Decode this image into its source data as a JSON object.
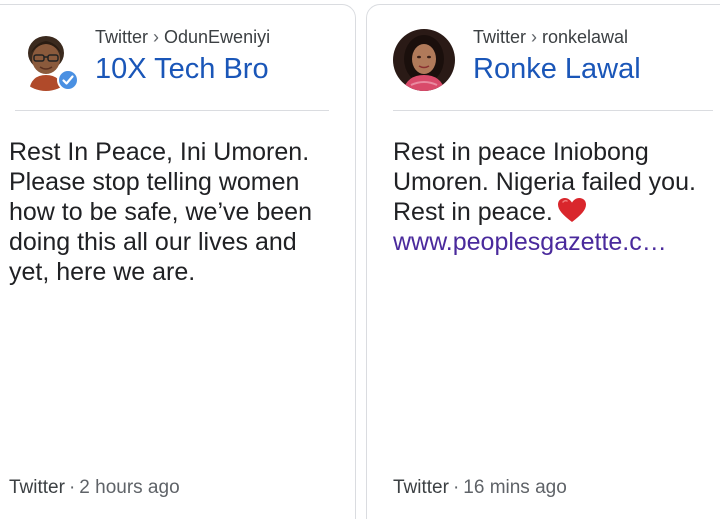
{
  "cards": [
    {
      "source": "Twitter",
      "handle": "OdunEweniyi",
      "separator": "›",
      "author": "10X Tech Bro",
      "verified": true,
      "avatar_icon": "memoji-avatar",
      "text": "Rest In Peace, Ini Umoren. Please stop telling women how to be safe, we’ve been doing this all our lives and yet, here we are.",
      "footer_source": "Twitter",
      "footer_dot": "·",
      "footer_time": "2 hours ago"
    },
    {
      "source": "Twitter",
      "handle": "ronkelawal",
      "separator": "›",
      "author": "Ronke Lawal",
      "verified": false,
      "avatar_icon": "profile-photo-avatar",
      "text": "Rest in peace Iniobong Umoren. Nigeria failed you. Rest in peace.",
      "emoji_icon": "red-heart-icon",
      "link": "www.peoplesgazette.c…",
      "footer_source": "Twitter",
      "footer_dot": "·",
      "footer_time": "16 mins ago"
    }
  ],
  "colors": {
    "author_link": "#1a56b8",
    "url_link": "#4a2a9c",
    "verified_badge": "#4a90e2",
    "heart": "#d9262c"
  }
}
